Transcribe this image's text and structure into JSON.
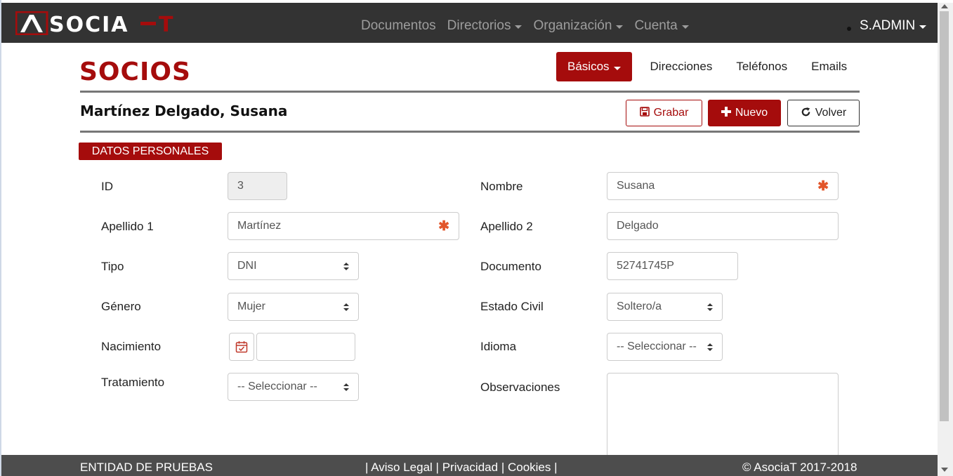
{
  "brand": {
    "logo_text": "ASOCIA-T"
  },
  "nav": {
    "links": [
      {
        "label": "Documentos"
      },
      {
        "label": "Directorios"
      },
      {
        "label": "Organización"
      },
      {
        "label": "Cuenta"
      }
    ],
    "user": "S.ADMIN"
  },
  "page": {
    "title": "SOCIOS",
    "person_name": "Martínez Delgado, Susana",
    "tabs": [
      "Básicos",
      "Direcciones",
      "Teléfonos",
      "Emails"
    ],
    "buttons": {
      "save": "Grabar",
      "new": "Nuevo",
      "back": "Volver"
    },
    "section": "DATOS PERSONALES"
  },
  "form": {
    "id": {
      "label": "ID",
      "value": "3"
    },
    "nombre": {
      "label": "Nombre",
      "value": "Susana",
      "required": "✱"
    },
    "apellido1": {
      "label": "Apellido 1",
      "value": "Martínez",
      "required": "✱"
    },
    "apellido2": {
      "label": "Apellido 2",
      "value": "Delgado"
    },
    "tipo": {
      "label": "Tipo",
      "value": "DNI"
    },
    "documento": {
      "label": "Documento",
      "value": "52741745P"
    },
    "genero": {
      "label": "Género",
      "value": "Mujer"
    },
    "estado_civil": {
      "label": "Estado Civil",
      "value": "Soltero/a"
    },
    "nacimiento": {
      "label": "Nacimiento",
      "value": ""
    },
    "idioma": {
      "label": "Idioma",
      "value": "-- Seleccionar --"
    },
    "tratamiento": {
      "label": "Tratamiento",
      "value": "-- Seleccionar --"
    },
    "observaciones": {
      "label": "Observaciones",
      "value": ""
    }
  },
  "footer": {
    "entity": "ENTIDAD DE PRUEBAS",
    "sep": "|",
    "links": [
      "Aviso Legal",
      "Privacidad",
      "Cookies"
    ],
    "copyright": "© AsociaT 2017-2018"
  },
  "colors": {
    "accent": "#a50c0c",
    "navbar": "#333333",
    "footer": "#4d4d4d"
  }
}
